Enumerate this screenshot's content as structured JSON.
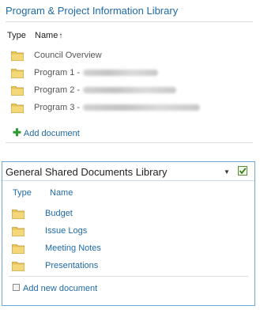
{
  "library1": {
    "title": "Program & Project Information Library",
    "col_type": "Type",
    "col_name": "Name",
    "sort_arrow": "↑",
    "items": [
      {
        "label": "Council Overview",
        "redacted": false
      },
      {
        "label": "Program 1 -",
        "redacted": true
      },
      {
        "label": "Program 2 -",
        "redacted": true
      },
      {
        "label": "Program 3 -",
        "redacted": true
      }
    ],
    "add_link": "Add document"
  },
  "library2": {
    "title": "General Shared Documents Library",
    "menu_glyph": "▼",
    "col_type": "Type",
    "col_name": "Name",
    "items": [
      {
        "label": "Budget"
      },
      {
        "label": "Issue Logs"
      },
      {
        "label": "Meeting Notes"
      },
      {
        "label": "Presentations"
      }
    ],
    "add_link": "Add new document"
  },
  "colors": {
    "link": "#1f6aa5",
    "folder": "#e8c458",
    "border": "#6fa7d6",
    "add_icon": "#2e9b2e"
  }
}
